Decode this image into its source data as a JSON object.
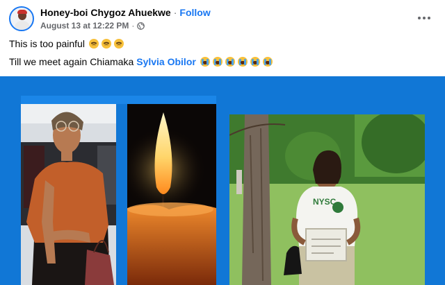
{
  "post": {
    "author": "Honey-boi Chygoz Ahuekwe",
    "separator": "·",
    "follow_label": "Follow",
    "timestamp": "August 13 at 12:22 PM",
    "meta_separator": "·",
    "audience_icon": "globe-icon",
    "more_icon": "more-options-icon",
    "line1": "This is too painful",
    "line1_emojis": [
      "pensive-face",
      "pensive-face",
      "pensive-face"
    ],
    "line2": "Till we meet again Chiamaka",
    "mention": "Sylvia Obilor",
    "line2_emojis": [
      "crying-face",
      "crying-face",
      "crying-face",
      "crying-face",
      "crying-face",
      "crying-face"
    ]
  },
  "photo": {
    "background": "#1177d6",
    "panels": [
      "woman-orange-blouse-photo",
      "lit-candle-photo",
      "woman-nysc-uniform-photo"
    ]
  }
}
